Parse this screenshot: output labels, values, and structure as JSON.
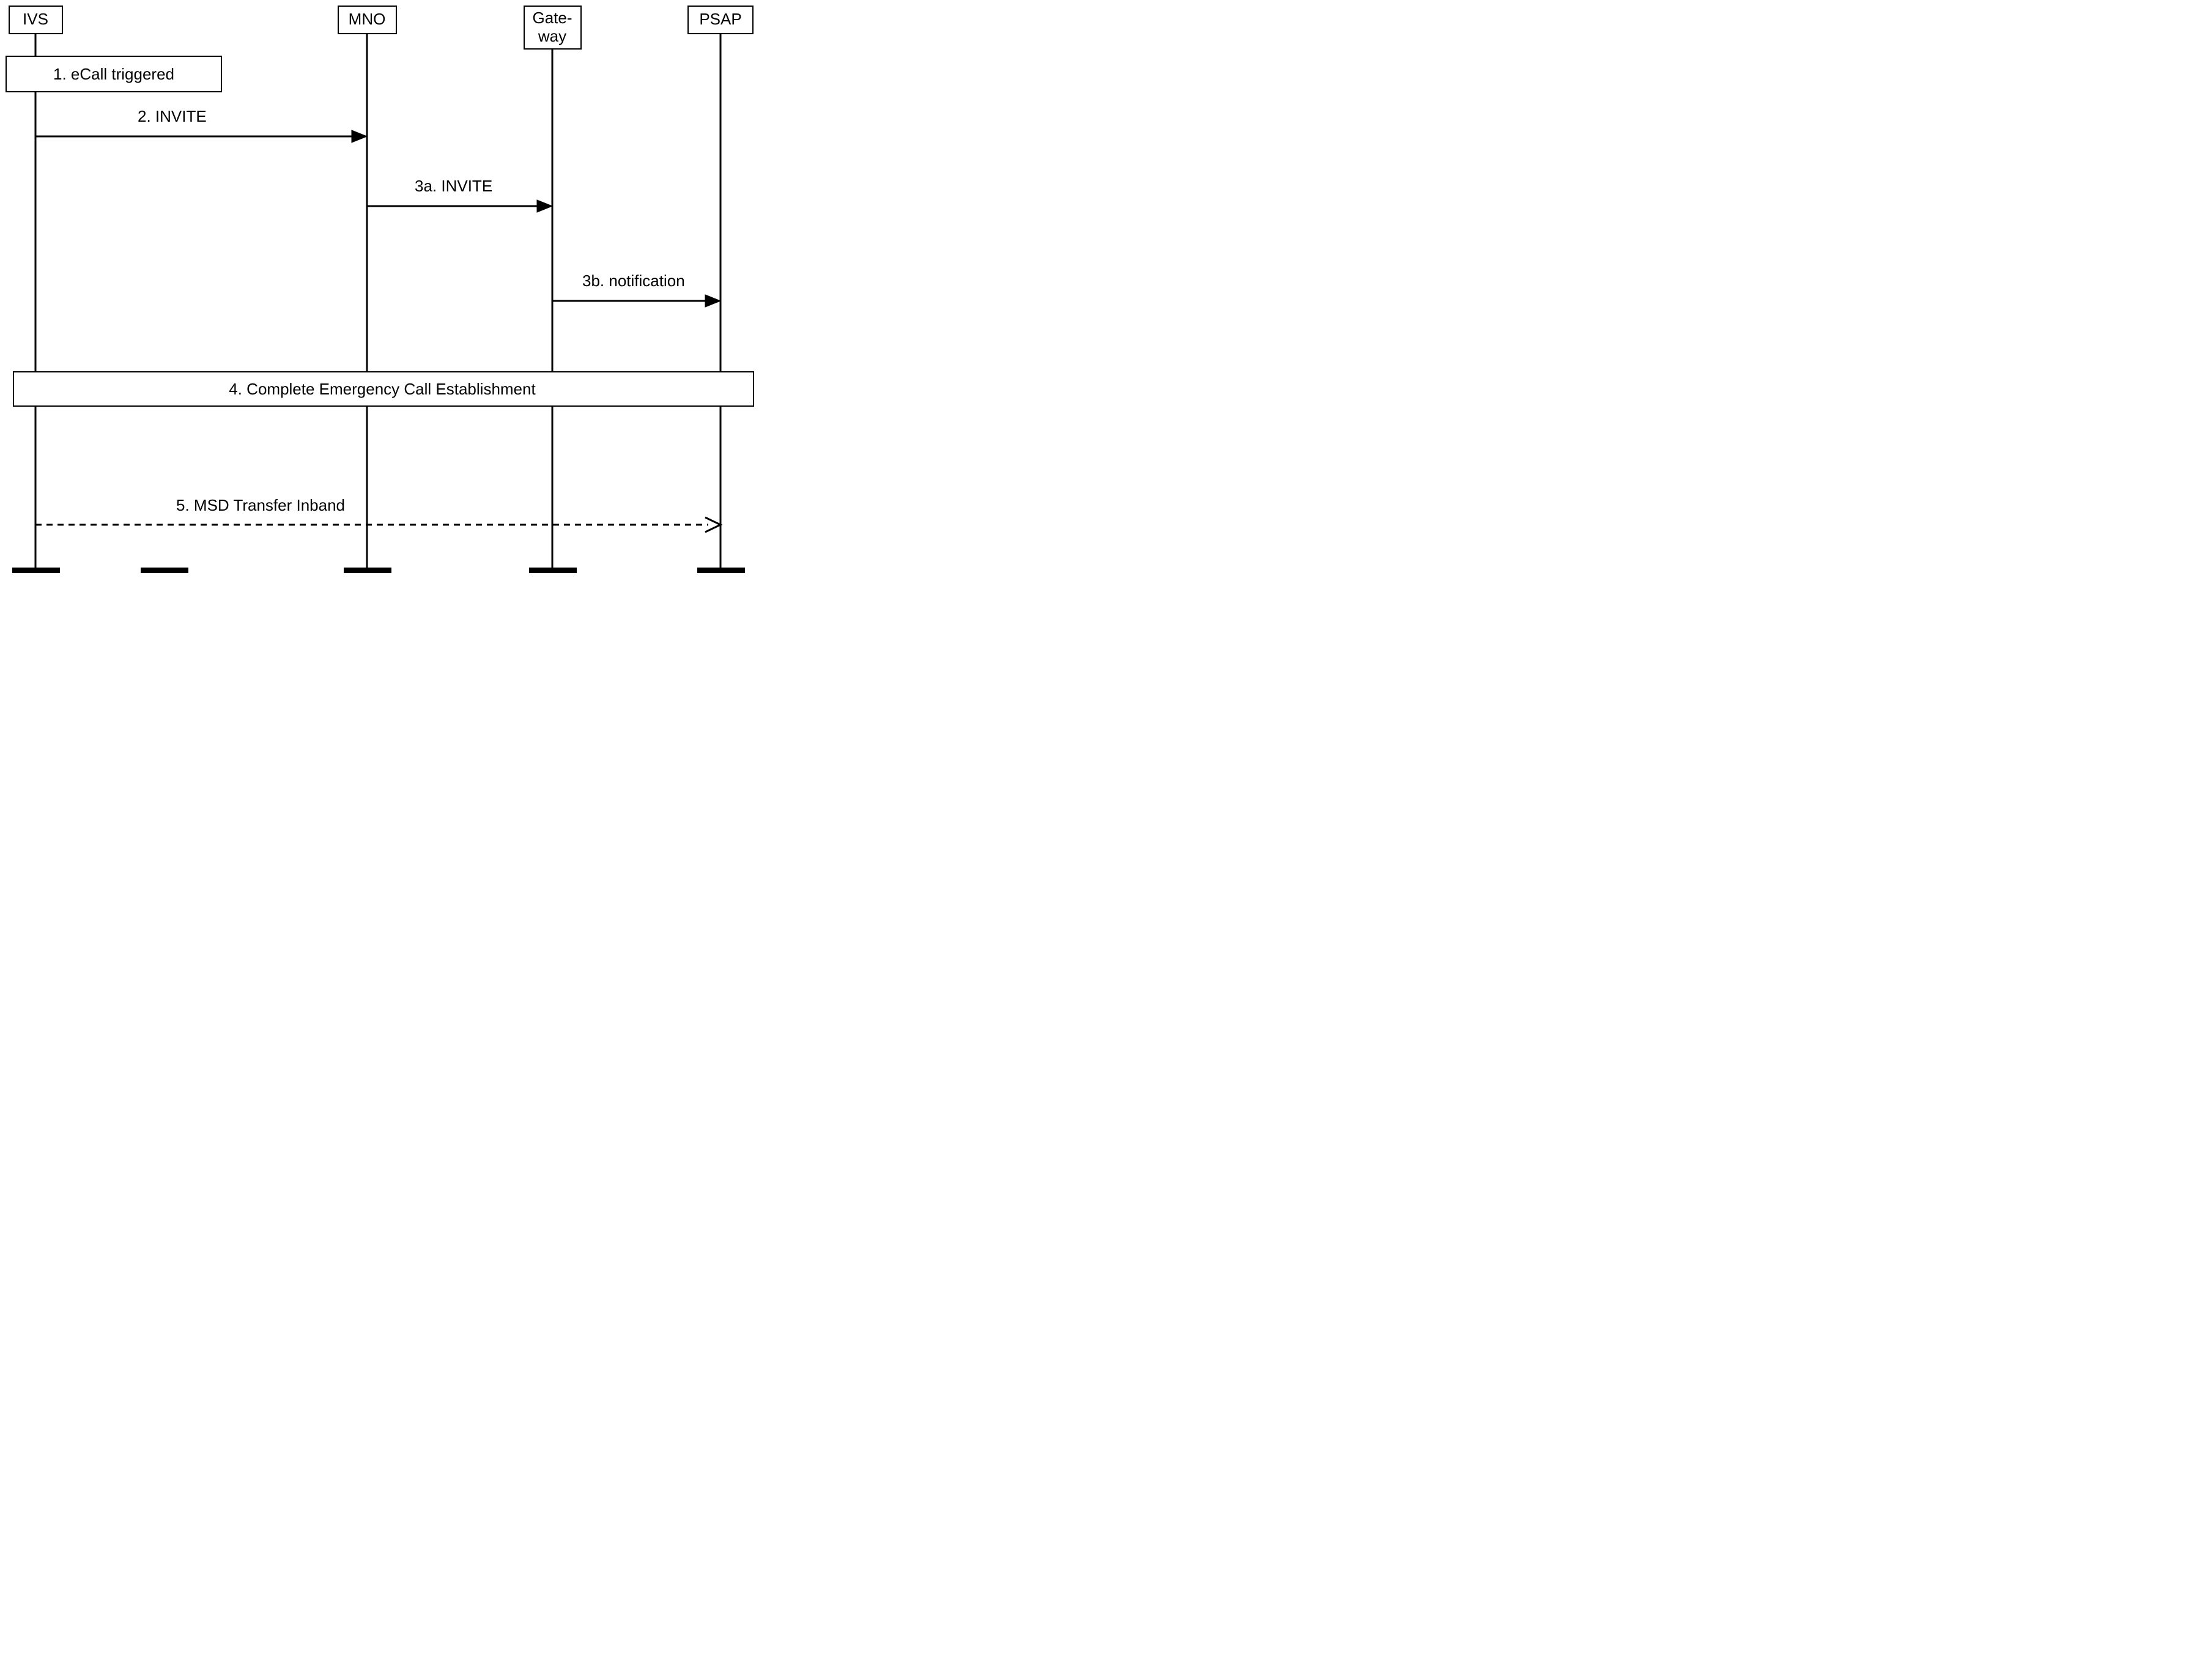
{
  "participants": {
    "ivs": {
      "label": "IVS"
    },
    "mno": {
      "label": "MNO"
    },
    "gateway_line1": "Gate-",
    "gateway_line2": "way",
    "psap": {
      "label": "PSAP"
    }
  },
  "events": {
    "step1": "1. eCall triggered",
    "step2": "2. INVITE",
    "step3a": "3a. INVITE",
    "step3b": "3b. notification",
    "step4": "4. Complete Emergency Call Establishment",
    "step5": "5. MSD Transfer Inband"
  }
}
